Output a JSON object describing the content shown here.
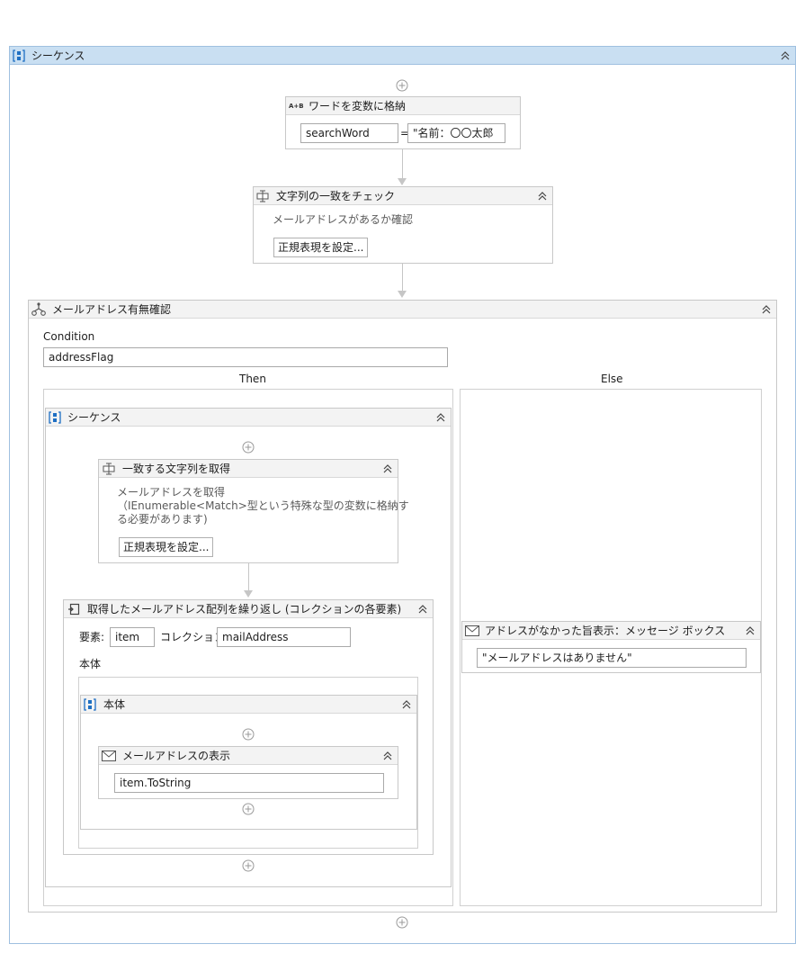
{
  "root": {
    "title": "シーケンス"
  },
  "assign": {
    "title": "ワードを変数に格納",
    "icon_text": "A+B",
    "variable": "searchWord",
    "equals": "=",
    "value": "\"名前：〇〇太郎"
  },
  "check": {
    "title": "文字列の一致をチェック",
    "description": "メールアドレスがあるか確認",
    "button": "正規表現を設定..."
  },
  "if_block": {
    "title": "メールアドレス有無確認",
    "condition_label": "Condition",
    "condition_value": "addressFlag",
    "then_label": "Then",
    "else_label": "Else"
  },
  "then_sequence": {
    "title": "シーケンス"
  },
  "matches": {
    "title": "一致する文字列を取得",
    "description_line1": "メールアドレスを取得",
    "description_line2": "（IEnumerable<Match>型という特殊な型の変数に格納す",
    "description_line3": "る必要があります)",
    "button": "正規表現を設定..."
  },
  "foreach": {
    "title": "取得したメールアドレス配列を繰り返し (コレクションの各要素)",
    "item_label": "要素:",
    "item_value": "item",
    "collection_label": "コレクション:",
    "collection_value": "mailAddress",
    "body_label": "本体"
  },
  "body_sequence": {
    "title": "本体"
  },
  "msgbox_show": {
    "title": "メールアドレスの表示",
    "value": "item.ToString"
  },
  "msgbox_else": {
    "title": "アドレスがなかった旨表示：メッセージ ボックス",
    "value": "\"メールアドレスはありません\""
  },
  "colors": {
    "root_header": "#c9dff2",
    "activity_header": "#f3f3f3",
    "sequence_icon": "#1e6fc3"
  }
}
